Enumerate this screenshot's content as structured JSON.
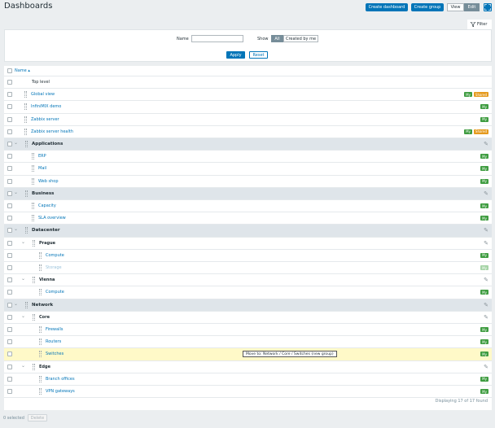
{
  "page": {
    "title": "Dashboards"
  },
  "toolbar": {
    "create_dashboard": "Create dashboard",
    "create_group": "Create group",
    "view": "View",
    "edit": "Edit"
  },
  "filter": {
    "tab_label": "Filter",
    "name_label": "Name",
    "name_value": "",
    "show_label": "Show",
    "show_options": [
      "All",
      "Created by me"
    ],
    "apply": "Apply",
    "reset": "Reset"
  },
  "table": {
    "header_name": "Name ▴",
    "rows": [
      {
        "level": 0,
        "type": "top",
        "name": "Top level",
        "badges": []
      },
      {
        "level": 0,
        "type": "item",
        "name": "Global view",
        "badges": [
          "My",
          "Shared"
        ]
      },
      {
        "level": 0,
        "type": "item",
        "name": "InfiniMIX demo",
        "badges": [
          "My"
        ]
      },
      {
        "level": 0,
        "type": "item",
        "name": "Zabbix server",
        "badges": [
          "My"
        ]
      },
      {
        "level": 0,
        "type": "item",
        "name": "Zabbix server health",
        "badges": [
          "My",
          "Shared"
        ]
      },
      {
        "level": 0,
        "type": "group",
        "name": "Applications",
        "badges": []
      },
      {
        "level": 1,
        "type": "item",
        "name": "ERP",
        "badges": [
          "My"
        ]
      },
      {
        "level": 1,
        "type": "item",
        "name": "Mail",
        "badges": [
          "My"
        ]
      },
      {
        "level": 1,
        "type": "item",
        "name": "Web shop",
        "badges": [
          "My"
        ]
      },
      {
        "level": 0,
        "type": "group",
        "name": "Business",
        "badges": []
      },
      {
        "level": 1,
        "type": "item",
        "name": "Capacity",
        "badges": [
          "My"
        ]
      },
      {
        "level": 1,
        "type": "item",
        "name": "SLA overview",
        "badges": [
          "My"
        ]
      },
      {
        "level": 0,
        "type": "group",
        "name": "Datacenter",
        "badges": []
      },
      {
        "level": 1,
        "type": "subgroup",
        "name": "Prague",
        "badges": []
      },
      {
        "level": 2,
        "type": "item",
        "name": "Compute",
        "badges": [
          "My"
        ]
      },
      {
        "level": 2,
        "type": "item-dim",
        "name": "Storage",
        "badges": [
          "My"
        ]
      },
      {
        "level": 1,
        "type": "subgroup",
        "name": "Vienna",
        "badges": []
      },
      {
        "level": 2,
        "type": "item",
        "name": "Compute",
        "badges": [
          "My"
        ]
      },
      {
        "level": 0,
        "type": "group",
        "name": "Network",
        "badges": []
      },
      {
        "level": 1,
        "type": "subgroup",
        "name": "Core",
        "badges": []
      },
      {
        "level": 2,
        "type": "item",
        "name": "Firewalls",
        "badges": [
          "My"
        ]
      },
      {
        "level": 2,
        "type": "item",
        "name": "Routers",
        "badges": [
          "My"
        ]
      },
      {
        "level": 2,
        "type": "item-hl",
        "name": "Switches",
        "badges": [
          "My"
        ],
        "tooltip": "Move to: Network / Core / Switches (new group)"
      },
      {
        "level": 1,
        "type": "subgroup",
        "name": "Edge",
        "badges": []
      },
      {
        "level": 2,
        "type": "item",
        "name": "Branch offices",
        "badges": [
          "My"
        ]
      },
      {
        "level": 2,
        "type": "item",
        "name": "VPN gateways",
        "badges": [
          "My"
        ]
      }
    ],
    "footer": "Displaying 17 of 17 found"
  },
  "bottom": {
    "selected": "0 selected",
    "delete": "Delete"
  },
  "colors": {
    "accent": "#0275b8",
    "my_badge": "#3e9c40",
    "shared_badge": "#e59a1e",
    "highlight": "#fff9c8"
  }
}
